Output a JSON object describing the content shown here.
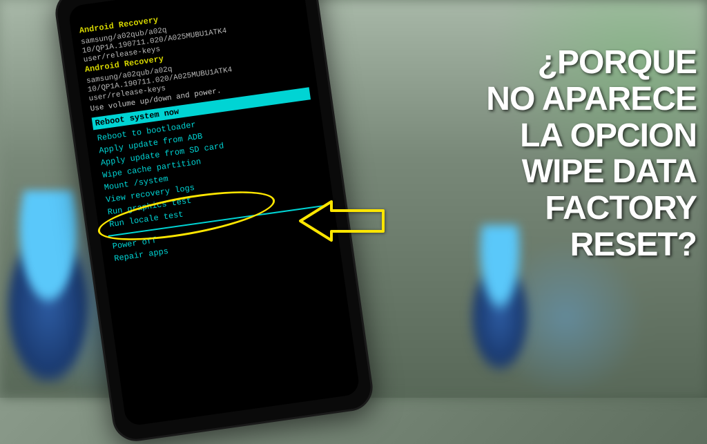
{
  "recovery": {
    "title": "Android Recovery",
    "device_line1": "samsung/a02qub/a02q",
    "device_line2": "10/QP1A.190711.020/A025MUBU1ATK4",
    "device_line3": "user/release-keys",
    "instruction": "Use volume up/down and power.",
    "selected_item": "Reboot system now",
    "menu_items": [
      "Reboot to bootloader",
      "Apply update from ADB",
      "Apply update from SD card",
      "Wipe cache partition",
      "Mount /system",
      "View recovery logs",
      "Run graphics test",
      "Run locale test"
    ],
    "menu_items_after": [
      "Power off",
      "Repair apps"
    ]
  },
  "overlay": {
    "line1": "¿PORQUE",
    "line2": "NO APARECE",
    "line3": "LA OPCION",
    "line4": "WIPE DATA",
    "line5": "FACTORY",
    "line6": "RESET?"
  },
  "colors": {
    "recovery_yellow": "#d4d400",
    "recovery_cyan": "#00d4d4",
    "annotation_yellow": "#ffe600"
  }
}
